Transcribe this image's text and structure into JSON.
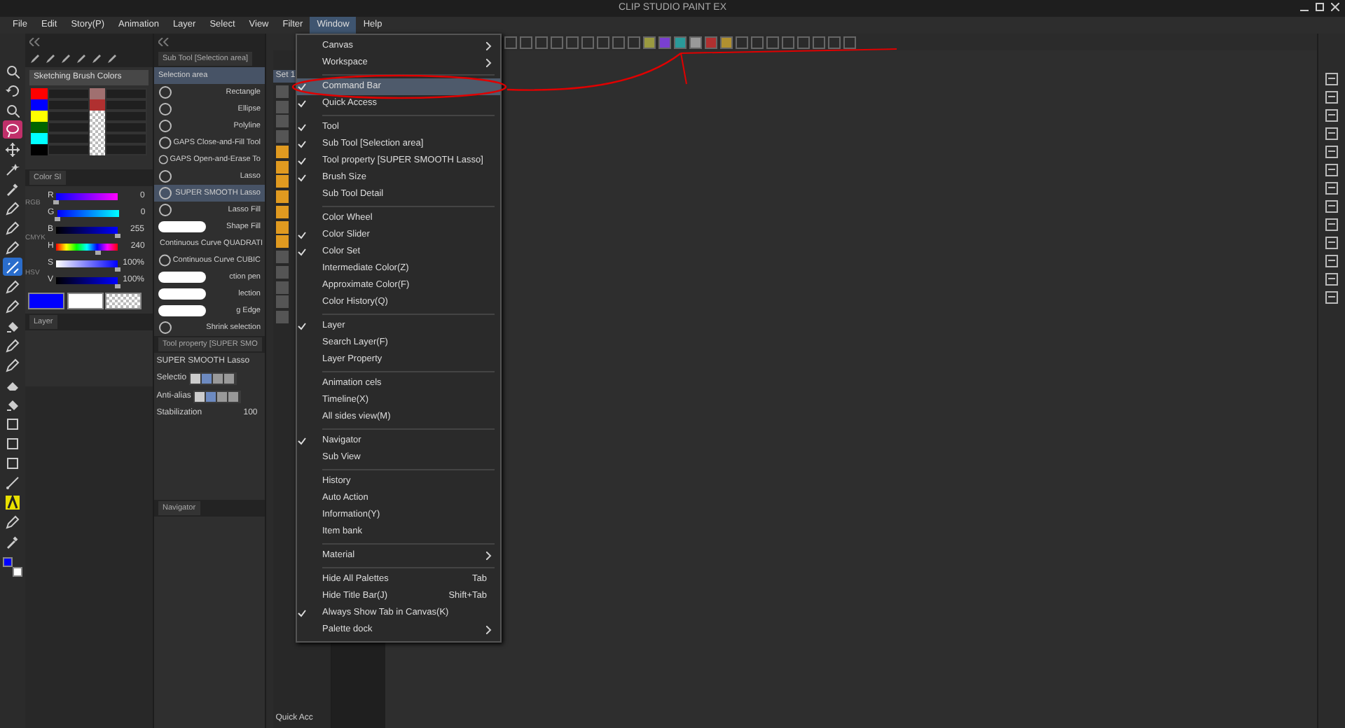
{
  "window": {
    "title": "CLIP STUDIO PAINT EX"
  },
  "menu_bar": [
    {
      "label": "File",
      "selected": false
    },
    {
      "label": "Edit",
      "selected": false
    },
    {
      "label": "Story(P)",
      "selected": false
    },
    {
      "label": "Animation",
      "selected": false
    },
    {
      "label": "Layer",
      "selected": false
    },
    {
      "label": "Select",
      "selected": false
    },
    {
      "label": "View",
      "selected": false
    },
    {
      "label": "Filter",
      "selected": false
    },
    {
      "label": "Window",
      "selected": true
    },
    {
      "label": "Help",
      "selected": false
    }
  ],
  "tools": [
    {
      "kind": "zoom",
      "selected": false
    },
    {
      "kind": "rotate",
      "selected": false
    },
    {
      "kind": "zoom",
      "selected": false
    },
    {
      "kind": "lasso",
      "selected": true
    },
    {
      "kind": "move",
      "selected": false
    },
    {
      "kind": "wand",
      "selected": false
    },
    {
      "kind": "dropper",
      "selected": false
    },
    {
      "kind": "pen",
      "selected": false
    },
    {
      "kind": "pen",
      "selected": false
    },
    {
      "kind": "pen",
      "selected": false
    },
    {
      "kind": "ruler",
      "selected": true
    },
    {
      "kind": "pen",
      "selected": false
    },
    {
      "kind": "pen",
      "selected": false
    },
    {
      "kind": "fill",
      "selected": false
    },
    {
      "kind": "pen",
      "selected": false
    },
    {
      "kind": "pen",
      "selected": false
    },
    {
      "kind": "eraser",
      "selected": false
    },
    {
      "kind": "fill",
      "selected": false
    },
    {
      "kind": "shape",
      "selected": false
    },
    {
      "kind": "shape",
      "selected": false
    },
    {
      "kind": "shape",
      "selected": false
    },
    {
      "kind": "line",
      "selected": false
    },
    {
      "kind": "text",
      "selected": false
    },
    {
      "kind": "pen",
      "selected": false
    },
    {
      "kind": "dropper",
      "selected": false
    }
  ],
  "main_colors": [
    {
      "color": "#0000ff"
    },
    {
      "color": "#ffffff"
    }
  ],
  "color_set": {
    "dropdown": "Sketching Brush Colors",
    "rows": [
      {
        "color": "#ff0000"
      },
      {
        "color": "#0000ff"
      },
      {
        "color": "#ffff00"
      },
      {
        "color": "#006400"
      },
      {
        "color": "#00ffff"
      },
      {
        "color": "#000000"
      }
    ],
    "second_column": [
      {
        "color": "#a07070"
      },
      {
        "color": "#b03030"
      }
    ]
  },
  "color_slider": {
    "tab": "Color Sl",
    "modes": [
      "RGB",
      "CMYK",
      "HSV"
    ],
    "channels": [
      {
        "name": "R",
        "value": "0",
        "level": 0,
        "kind": "r"
      },
      {
        "name": "G",
        "value": "0",
        "level": 0,
        "kind": "g"
      },
      {
        "name": "B",
        "value": "255",
        "level": 1,
        "kind": "b"
      },
      {
        "name": "H",
        "value": "240",
        "level": 0.667,
        "kind": "h"
      },
      {
        "name": "S",
        "value": "100%",
        "level": 1,
        "kind": "s"
      },
      {
        "name": "V",
        "value": "100%",
        "level": 1,
        "kind": "v"
      }
    ],
    "swatches": [
      {
        "color": "#0000ff",
        "kind": "solid"
      },
      {
        "color": "#ffffff",
        "kind": "solid"
      },
      {
        "kind": "transparent"
      }
    ]
  },
  "layer_panel": {
    "tab": "Layer"
  },
  "sub_tool": {
    "header": "Sub Tool [Selection area]",
    "group": "Selection area",
    "items": [
      {
        "label": "Rectangle",
        "kind": "icon",
        "selected": false
      },
      {
        "label": "Ellipse",
        "kind": "icon",
        "selected": false
      },
      {
        "label": "Polyline",
        "kind": "icon",
        "selected": false
      },
      {
        "label": "GAPS Close-and-Fill Tool",
        "kind": "icon",
        "selected": false
      },
      {
        "label": "GAPS Open-and-Erase To",
        "kind": "icon",
        "selected": false
      },
      {
        "label": "Lasso",
        "kind": "icon",
        "selected": false
      },
      {
        "label": "SUPER SMOOTH Lasso",
        "kind": "icon",
        "selected": true
      },
      {
        "label": "Lasso Fill",
        "kind": "icon",
        "selected": false
      },
      {
        "label": "Shape Fill",
        "kind": "stroke",
        "selected": false
      },
      {
        "label": "Continuous Curve QUADRATI",
        "kind": "icon",
        "selected": false
      },
      {
        "label": "Continuous Curve CUBIC",
        "kind": "icon",
        "selected": false
      },
      {
        "label": "ction pen",
        "kind": "stroke",
        "selected": false
      },
      {
        "label": "lection",
        "kind": "stroke",
        "selected": false
      },
      {
        "label": "g Edge",
        "kind": "stroke",
        "selected": false
      },
      {
        "label": "Shrink selection",
        "kind": "icon",
        "selected": false
      }
    ]
  },
  "tool_property": {
    "header": "Tool property [SUPER SMO",
    "tool_name": "SUPER SMOOTH Lasso",
    "rows": [
      {
        "label": "Selectio"
      },
      {
        "label": "Anti-alias"
      }
    ],
    "stabilization": {
      "label": "Stabilization",
      "value": "100"
    }
  },
  "navigator": {
    "tab": "Navigator"
  },
  "sub_tool_strip": {
    "set": "Set 1",
    "quick_access": "Quick Acc"
  },
  "window_menu": {
    "groups": [
      [
        {
          "label": "Canvas",
          "checked": false,
          "submenu": true,
          "highlighted": false
        },
        {
          "label": "Workspace",
          "checked": false,
          "submenu": true,
          "highlighted": false
        }
      ],
      [
        {
          "label": "Command Bar",
          "checked": true,
          "submenu": false,
          "highlighted": true
        },
        {
          "label": "Quick Access",
          "checked": true,
          "submenu": false,
          "highlighted": false
        }
      ],
      [
        {
          "label": "Tool",
          "checked": true,
          "submenu": false,
          "highlighted": false
        },
        {
          "label": "Sub Tool [Selection area]",
          "checked": true,
          "submenu": false,
          "highlighted": false
        },
        {
          "label": "Tool property [SUPER SMOOTH Lasso]",
          "checked": true,
          "submenu": false,
          "highlighted": false
        },
        {
          "label": "Brush Size",
          "checked": true,
          "submenu": false,
          "highlighted": false
        },
        {
          "label": "Sub Tool Detail",
          "checked": false,
          "submenu": false,
          "highlighted": false
        }
      ],
      [
        {
          "label": "Color Wheel",
          "checked": false,
          "submenu": false,
          "highlighted": false
        },
        {
          "label": "Color Slider",
          "checked": true,
          "submenu": false,
          "highlighted": false
        },
        {
          "label": "Color Set",
          "checked": true,
          "submenu": false,
          "highlighted": false
        },
        {
          "label": "Intermediate Color(Z)",
          "checked": false,
          "submenu": false,
          "highlighted": false
        },
        {
          "label": "Approximate Color(F)",
          "checked": false,
          "submenu": false,
          "highlighted": false
        },
        {
          "label": "Color History(Q)",
          "checked": false,
          "submenu": false,
          "highlighted": false
        }
      ],
      [
        {
          "label": "Layer",
          "checked": true,
          "submenu": false,
          "highlighted": false
        },
        {
          "label": "Search Layer(F)",
          "checked": false,
          "submenu": false,
          "highlighted": false
        },
        {
          "label": "Layer Property",
          "checked": false,
          "submenu": false,
          "highlighted": false
        }
      ],
      [
        {
          "label": "Animation cels",
          "checked": false,
          "submenu": false,
          "highlighted": false
        },
        {
          "label": "Timeline(X)",
          "checked": false,
          "submenu": false,
          "highlighted": false
        },
        {
          "label": "All sides view(M)",
          "checked": false,
          "submenu": false,
          "highlighted": false
        }
      ],
      [
        {
          "label": "Navigator",
          "checked": true,
          "submenu": false,
          "highlighted": false
        },
        {
          "label": "Sub View",
          "checked": false,
          "submenu": false,
          "highlighted": false
        }
      ],
      [
        {
          "label": "History",
          "checked": false,
          "submenu": false,
          "highlighted": false
        },
        {
          "label": "Auto Action",
          "checked": false,
          "submenu": false,
          "highlighted": false
        },
        {
          "label": "Information(Y)",
          "checked": false,
          "submenu": false,
          "highlighted": false
        },
        {
          "label": "Item bank",
          "checked": false,
          "submenu": false,
          "highlighted": false
        }
      ],
      [
        {
          "label": "Material",
          "checked": false,
          "submenu": true,
          "highlighted": false
        }
      ],
      [
        {
          "label": "Hide All Palettes",
          "checked": false,
          "submenu": false,
          "highlighted": false,
          "shortcut": "Tab"
        },
        {
          "label": "Hide Title Bar(J)",
          "checked": false,
          "submenu": false,
          "highlighted": false,
          "shortcut": "Shift+Tab"
        },
        {
          "label": "Always Show Tab in Canvas(K)",
          "checked": true,
          "submenu": false,
          "highlighted": false
        },
        {
          "label": "Palette dock",
          "checked": false,
          "submenu": true,
          "highlighted": false
        }
      ]
    ]
  }
}
